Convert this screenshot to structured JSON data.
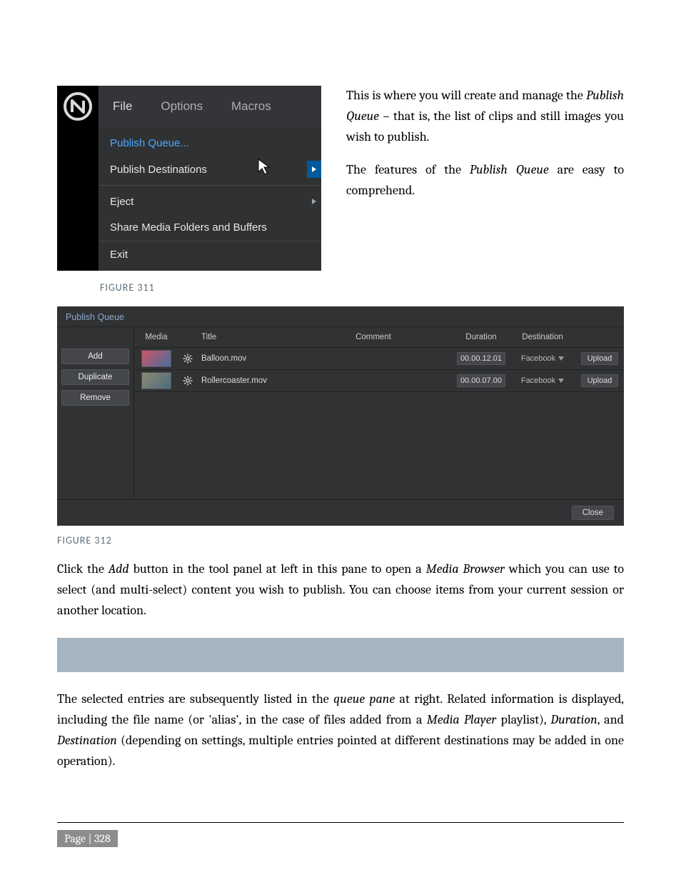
{
  "menu": {
    "file": "File",
    "options": "Options",
    "macros": "Macros",
    "items": {
      "publish_queue": "Publish Queue...",
      "publish_dest": "Publish Destinations",
      "eject": "Eject",
      "share": "Share Media Folders and Buffers",
      "exit": "Exit"
    }
  },
  "intro": {
    "p1a": "This is where you will create and manage the ",
    "p1_em": "Publish Queue",
    "p1b": " – that is, the list of clips and still images you wish to publish.",
    "p2a": "The features of the ",
    "p2_em": "Publish Queue",
    "p2b": " are easy to comprehend."
  },
  "captions": {
    "fig311": "FIGURE 311",
    "fig312": "FIGURE 312"
  },
  "queue": {
    "title": "Publish Queue",
    "buttons": {
      "add": "Add",
      "duplicate": "Duplicate",
      "remove": "Remove"
    },
    "headers": {
      "media": "Media",
      "title": "Title",
      "comment": "Comment",
      "duration": "Duration",
      "destination": "Destination"
    },
    "rows": [
      {
        "title": "Balloon.mov",
        "duration": "00.00.12.01",
        "dest": "Facebook",
        "upload": "Upload"
      },
      {
        "title": "Rollercoaster.mov",
        "duration": "00.00.07.00",
        "dest": "Facebook",
        "upload": "Upload"
      }
    ],
    "close": "Close"
  },
  "paras": {
    "p3a": "Click the ",
    "p3_em1": "Add",
    "p3b": " button in the tool panel at left in this pane to open a ",
    "p3_em2": "Media Browser",
    "p3c": " which you can use to select (and multi-select) content you wish to publish.  You can choose items from your current session or another location.",
    "p4a": "The selected entries are subsequently listed in the ",
    "p4_em1": "queue pane",
    "p4b": " at right.  Related information is displayed, including the file name (or 'alias', in the case of files added from a ",
    "p4_em2": "Media Player",
    "p4c": " playlist), ",
    "p4_em3": "Duration",
    "p4d": ", and ",
    "p4_em4": "Destination",
    "p4e": " (depending on settings, multiple entries pointed at different destinations may be added in one operation)."
  },
  "footer": {
    "page": "Page | 328"
  }
}
